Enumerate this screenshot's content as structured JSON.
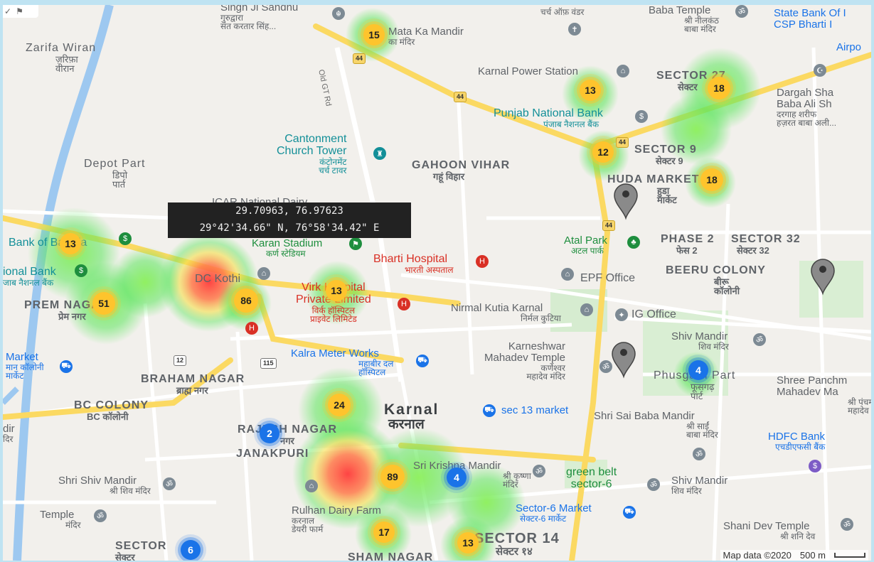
{
  "colors": {
    "water": "#9dc8f0",
    "highway": "#fbd962",
    "heat_low": "#5de65d",
    "heat_high": "#ff4b4b",
    "cluster_large": "#fec42d",
    "cluster_small": "#1a73e8",
    "marker": "#8a8a8a"
  },
  "coordinate_readout": {
    "decimal": "29.70963, 76.97623",
    "dms": "29°42'34.66\" N, 76°58'34.42\" E"
  },
  "attribution": {
    "map_data": "Map data ©2020",
    "scale": "500 m"
  },
  "corner_tools": {
    "check": "✓",
    "flag": "⚑"
  },
  "road_labels": {
    "old_gt_rd": "Old GT Rd"
  },
  "highway_shields": [
    "44",
    "44",
    "44",
    "44",
    "12",
    "115"
  ],
  "clusters": [
    {
      "count": "15",
      "level": "large"
    },
    {
      "count": "13",
      "level": "large"
    },
    {
      "count": "18",
      "level": "large"
    },
    {
      "count": "12",
      "level": "large"
    },
    {
      "count": "18",
      "level": "large"
    },
    {
      "count": "13",
      "level": "large"
    },
    {
      "count": "51",
      "level": "large"
    },
    {
      "count": "86",
      "level": "large"
    },
    {
      "count": "13",
      "level": "large"
    },
    {
      "count": "24",
      "level": "large"
    },
    {
      "count": "2",
      "level": "small"
    },
    {
      "count": "89",
      "level": "large"
    },
    {
      "count": "4",
      "level": "small"
    },
    {
      "count": "17",
      "level": "large"
    },
    {
      "count": "13",
      "level": "large"
    },
    {
      "count": "6",
      "level": "small"
    },
    {
      "count": "4",
      "level": "small"
    }
  ],
  "labels": {
    "singh_ji_sandhu": {
      "en": "Singh Ji Sandhu",
      "hi": "गुरुद्वारा\nसंत करतार सिंह..."
    },
    "mata_ka_mandir": {
      "en": "Mata Ka Mandir",
      "hi": "का मंदिर"
    },
    "church_of_hindi": {
      "en": "चर्च ऑफ़ वंडर"
    },
    "baba_temple": {
      "en": "Baba Temple",
      "hi": "श्री नीलकंठ\nबाबा मंदिर"
    },
    "sbi": {
      "en": "State Bank Of I\nCSP Bharti I"
    },
    "airport": {
      "en": "Airpo"
    },
    "zarifa_wiran": {
      "en": "Zarifa Wiran",
      "hi": "ज़रिफ़ा\nवीरान"
    },
    "karnal_power_station": {
      "en": "Karnal Power Station"
    },
    "sector_27": {
      "en": "SECTOR 27",
      "hi": "सेक्टर"
    },
    "dargah": {
      "en": "Dargah Sha\nBaba Ali Sh",
      "hi": "दरगाह शरीफ\nहज़रत बाबा अली..."
    },
    "punjab_national_bank": {
      "en": "Punjab National Bank",
      "hi": "पंजाब नैशनल बैंक"
    },
    "cantonment_church": {
      "en": "Cantonment\nChurch Tower",
      "hi": "कंटोनमेंट\nचर्च टावर"
    },
    "gahoon_vihar": {
      "en": "GAHOON VIHAR",
      "hi": "गहूं विहार"
    },
    "sector_9": {
      "en": "SECTOR 9",
      "hi": "सेक्टर 9"
    },
    "depot_part": {
      "en": "Depot Part",
      "hi": "डिपो\nपार्त"
    },
    "huda_market": {
      "en": "HUDA MARKET",
      "hi": "हुडा\nमार्केट"
    },
    "icar": {
      "en": "ICAR National Dairy"
    },
    "atal_park": {
      "en": "Atal Park",
      "hi": "अटल पार्क"
    },
    "phase2": {
      "en": "PHASE 2",
      "hi": "फेस 2"
    },
    "sector_32": {
      "en": "SECTOR 32",
      "hi": "सेक्टर 32"
    },
    "bank_of_baroda": {
      "en": "Bank of Baroda"
    },
    "karan_stadium": {
      "en": "Karan Stadium",
      "hi": "कर्ण स्टेडियम"
    },
    "bharti_hospital": {
      "en": "Bharti Hospital",
      "hi": "भारती अस्पताल"
    },
    "epf_office": {
      "en": "EPF Office"
    },
    "beeru_colony": {
      "en": "BEERU COLONY",
      "hi": "बीरू\nकॉलोनी"
    },
    "national_bank": {
      "en": "ional Bank",
      "hi": "जाब नैशनल बैंक"
    },
    "dc_kothi": {
      "en": "DC Kothi"
    },
    "virk_hospital": {
      "en": "Virk Hospital\nPrivate Limited",
      "hi": "विर्क हॉस्पिटल\nप्राइवेट लिमिटेड"
    },
    "prem_nagar": {
      "en": "PREM NAGAR",
      "hi": "प्रेम नगर"
    },
    "nirmal_kutia": {
      "en": "Nirmal Kutia Karnal",
      "hi": "निर्मल कुटिया"
    },
    "ig_office": {
      "en": "IG Office"
    },
    "shiv_mandir_top": {
      "en": "Shiv Mandir",
      "hi": "शिव मंदिर"
    },
    "market_left": {
      "en": "Market",
      "hi": "मान कॉलोनी\nमार्केट"
    },
    "kalra_meter": {
      "en": "Kalra Meter Works",
      "hi": "महाबीर दल\nहॉस्पिटल"
    },
    "karneshwar": {
      "en": "Karneshwar\nMahadev Temple",
      "hi": "कर्णेश्वर\nमहादेव मंदिर"
    },
    "phusgarh_part": {
      "en": "Phusgarh Part",
      "hi": "फूसगढ़\nपार्ट"
    },
    "shree_panch": {
      "en": "Shree Panchm\nMahadev Ma",
      "hi": "श्री पंचम\nमहादेव"
    },
    "braham_nagar": {
      "en": "BRAHAM NAGAR",
      "hi": "ब्राह्म नगर"
    },
    "bc_colony": {
      "en": "BC COLONY",
      "hi": "BC कॉलोनी"
    },
    "karnal": {
      "en": "Karnal",
      "hi": "करनाल"
    },
    "sec13_market": {
      "en": "sec 13 market"
    },
    "shri_sai_baba": {
      "en": "Shri Sai Baba Mandir",
      "hi": "श्री साईं\nबाबा मंदिर"
    },
    "hdfc_bank": {
      "en": "HDFC Bank",
      "hi": "एचडीएफसी बैंक"
    },
    "left_edge_dir": {
      "en": "dir",
      "hi": "दिर"
    },
    "rajesh_nagar": {
      "en": "RAJESH NAGAR",
      "hi": "नगर"
    },
    "janakpuri": {
      "en": "JANAKPURI"
    },
    "sri_krishna": {
      "en": "Sri Krishna Mandir",
      "hi": "श्री कृष्णा\nमंदिर"
    },
    "green_belt": {
      "en": "green belt\nsector-6"
    },
    "shiv_mandir_right": {
      "en": "Shiv Mandir",
      "hi": "शिव मंदिर"
    },
    "shri_shiv_mandir": {
      "en": "Shri Shiv Mandir",
      "hi": "श्री शिव मंदिर"
    },
    "temple_left": {
      "en": "Temple",
      "hi": "मंदिर"
    },
    "rulhan_dairy": {
      "en": "Rulhan Dairy Farm",
      "hi": "करनाल\nडेयरी फार्म"
    },
    "sector6_market": {
      "en": "Sector-6 Market",
      "hi": "सेक्टर-6 मार्केट"
    },
    "shani_dev": {
      "en": "Shani Dev Temple",
      "hi": "श्री शनि देव"
    },
    "sector_left": {
      "en": "SECTOR",
      "hi": "सेक्टर"
    },
    "sham_nagar": {
      "en": "SHAM NAGAR"
    },
    "sector_14": {
      "en": "SECTOR 14",
      "hi": "सेक्टर १४"
    }
  }
}
